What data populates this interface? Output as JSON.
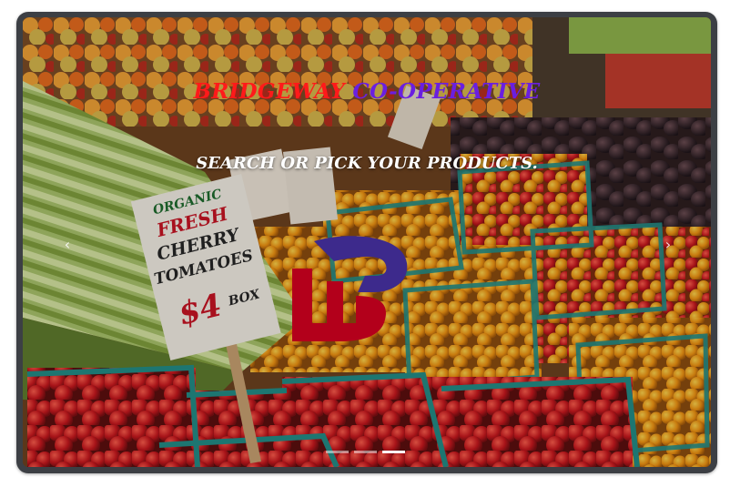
{
  "hero": {
    "brand_word_1": "BRIDGEWAY",
    "brand_word_2": "CO-OPERATIVE",
    "tagline": "SEARCH OR PICK YOUR PRODUCTS.",
    "prev_label": "‹",
    "next_label": "›",
    "slide_count": 3,
    "active_slide": 3
  },
  "sign": {
    "line1": "ORGANIC",
    "line2": "FRESH",
    "line3": "CHERRY",
    "line4": "TOMATOES",
    "price": "$4",
    "unit": "BOX"
  },
  "colors": {
    "brand_word_1": "#ff1a1a",
    "brand_word_2": "#6a1fe0",
    "logo_red": "#b3001b",
    "logo_purple": "#3d2a8c",
    "frame": "#3c3f44"
  }
}
